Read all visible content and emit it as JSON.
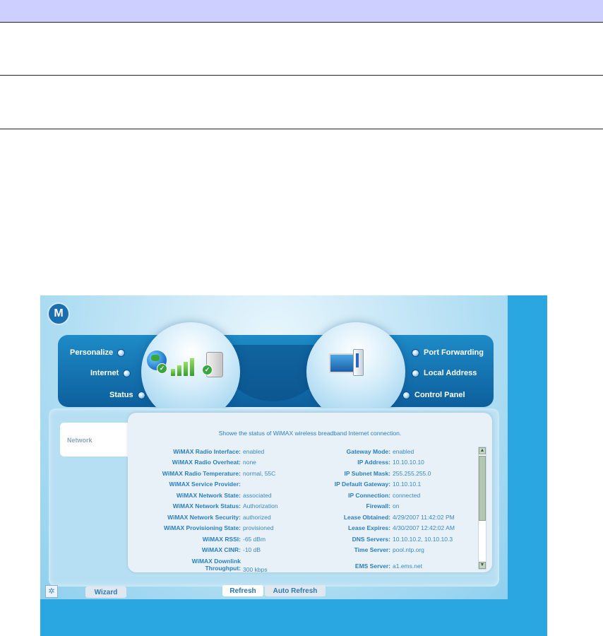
{
  "app": {
    "logo_symbol": "M",
    "nav": {
      "left": [
        {
          "label": "Personalize"
        },
        {
          "label": "Internet"
        },
        {
          "label": "Status"
        }
      ],
      "right": [
        {
          "label": "Port Forwarding"
        },
        {
          "label": "Local Address"
        },
        {
          "label": "Control Panel"
        }
      ]
    },
    "side_tab": "Network",
    "description": "Showe the status of WiMAX wireless breadband Internet connection.",
    "status_left": [
      {
        "label": "WiMAX Radio Interface:",
        "value": "enabled"
      },
      {
        "label": "WiMAX Radio Overheat:",
        "value": "none"
      },
      {
        "label": "WiMAX Radio Temperature:",
        "value": "normal, 55C"
      },
      {
        "label": "WiMAX Service Provider:",
        "value": ""
      },
      {
        "label": "WiMAX Network State:",
        "value": "associated"
      },
      {
        "label": "WiMAX Network Status:",
        "value": "Authorization"
      },
      {
        "label": "WiMAX Network Security:",
        "value": "authorized"
      },
      {
        "label": "WiMAX Provisioning State:",
        "value": "provisioned"
      },
      {
        "label": "WiMAX RSSI:",
        "value": "-65 dBm"
      },
      {
        "label": "WiMAX CINR:",
        "value": "-10 dB"
      },
      {
        "label": "WiMAX Downlink Throughput:",
        "value": "300 kbps"
      }
    ],
    "status_right": [
      {
        "label": "Gateway Mode:",
        "value": "enabled"
      },
      {
        "label": "IP Address:",
        "value": "10.10.10.10"
      },
      {
        "label": "IP Subnet Mask:",
        "value": "255.255.255.0"
      },
      {
        "label": "IP Default Gateway:",
        "value": "10.10.10.1"
      },
      {
        "label": "IP Connection:",
        "value": "connected"
      },
      {
        "label": "Firewall:",
        "value": "on"
      },
      {
        "label": "Lease Obtained:",
        "value": "4/29/2007 11:42:02 PM"
      },
      {
        "label": "Lease Expires:",
        "value": "4/30/2007 12:42:02 AM"
      },
      {
        "label": "DNS Servers:",
        "value": "10.10.10.2, 10.10.10.3"
      },
      {
        "label": "Time Server:",
        "value": "pool.ntp.org"
      },
      {
        "label": "EMS Server:",
        "value": "a1.ems.net"
      }
    ],
    "buttons": {
      "wizard": "Wizard",
      "refresh": "Refresh",
      "auto_refresh": "Auto Refresh"
    },
    "icons": {
      "logo": "motorola-logo-icon",
      "network_status": "globe-signal-check-icon",
      "local_network": "computer-icon",
      "corner": "snowflake-icon"
    },
    "colors": {
      "background": "#2aa6e0",
      "nav_band": "#0d5f9c",
      "label_text": "#2b7fc0",
      "doc_header": "#cccfff"
    }
  }
}
